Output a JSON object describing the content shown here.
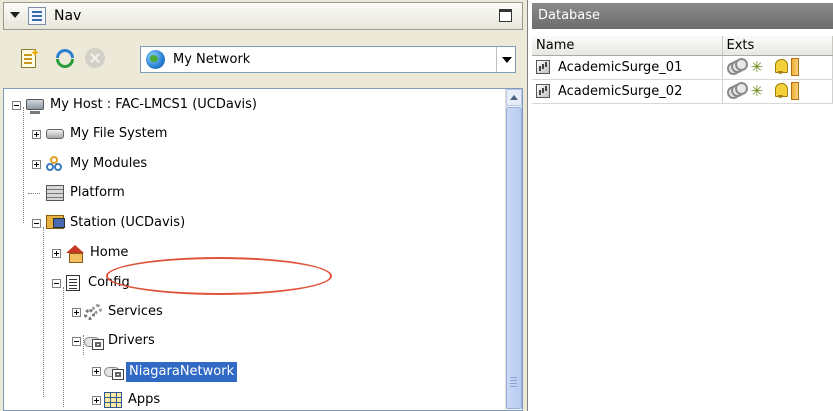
{
  "nav": {
    "title": "Nav",
    "network_select": {
      "value": "My Network"
    },
    "tree": {
      "host": "My Host : FAC-LMCS1 (UCDavis)",
      "file_system": "My File System",
      "modules": "My Modules",
      "platform": "Platform",
      "station": "Station (UCDavis)",
      "home": "Home",
      "config": "Config",
      "services": "Services",
      "drivers": "Drivers",
      "niagara_network": "NiagaraNetwork",
      "apps": "Apps"
    }
  },
  "database": {
    "title": "Database",
    "columns": {
      "name": "Name",
      "exts": "Exts"
    },
    "rows": [
      {
        "name": "AcademicSurge_01"
      },
      {
        "name": "AcademicSurge_02"
      }
    ],
    "ext_icons": [
      "history-ext-icon",
      "trend-ext-icon",
      "alarm-ext-icon",
      "more-ext-icon"
    ]
  },
  "colors": {
    "selection": "#316ac5",
    "highlight_oval": "#e0533a",
    "db_header": "#7a7a7a"
  }
}
